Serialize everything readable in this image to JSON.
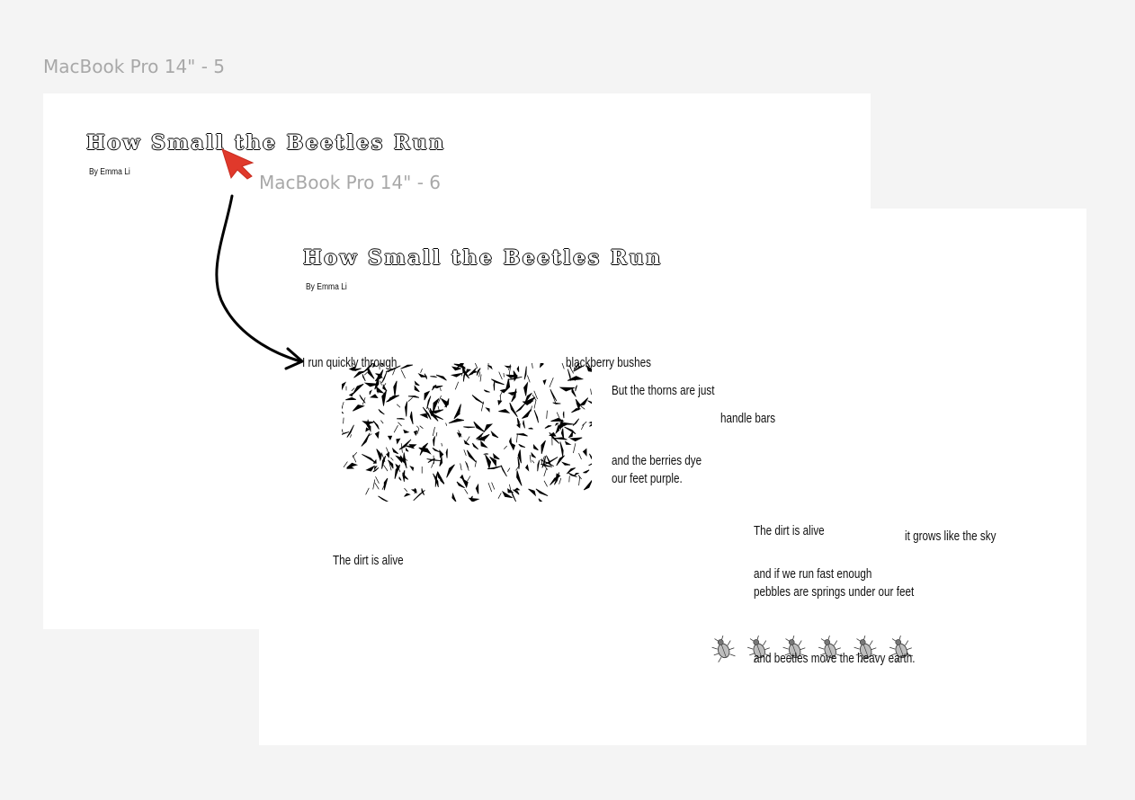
{
  "frames": {
    "frame5": {
      "label": "MacBook Pro 14\" - 5",
      "title": "How Small the Beetles Run",
      "byline": "By Emma Li"
    },
    "frame6": {
      "label": "MacBook Pro 14\" - 6",
      "title": "How Small the Beetles Run",
      "byline": "By Emma Li",
      "lines": {
        "run": "I run quickly through",
        "bushes": "blackberry bushes",
        "thorns": "But the thorns are just",
        "handlebars": "handle bars",
        "dye1": "and the berries dye",
        "dye2": "our feet purple.",
        "dirt_left": "The dirt is alive",
        "dirt_right": "The dirt is alive",
        "sky": "it grows like the sky",
        "fast1": "and if we run fast enough",
        "fast2": "pebbles are springs under our feet",
        "earth": "and beetles move the heavy earth."
      }
    }
  },
  "decor": {
    "bramble_image": "blackberry-bramble-illustration",
    "beetle_icon": "beetle-icon",
    "beetle_count": 6,
    "cursor_color": "#e0392b",
    "canvas_bg": "#f4f4f4"
  }
}
